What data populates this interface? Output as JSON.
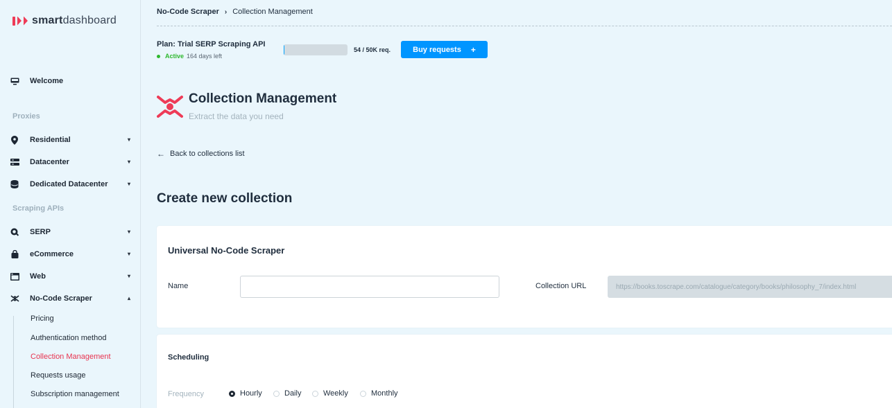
{
  "brand": {
    "bold": "smart",
    "light": "dashboard"
  },
  "sidebar": {
    "welcome": "Welcome",
    "section_proxies": "Proxies",
    "residential": "Residential",
    "datacenter": "Datacenter",
    "dedicated": "Dedicated Datacenter",
    "section_scraping": "Scraping APIs",
    "serp": "SERP",
    "ecommerce": "eCommerce",
    "web": "Web",
    "nocode": "No-Code Scraper",
    "sub": [
      "Pricing",
      "Authentication method",
      "Collection Management",
      "Requests usage",
      "Subscription management"
    ]
  },
  "breadcrumb": {
    "parent": "No-Code Scraper",
    "current": "Collection Management"
  },
  "plan": {
    "name": "Plan: Trial SERP Scraping API",
    "status": "Active",
    "days_left": "164 days left",
    "requests": "54 / 50K req.",
    "usage_fraction": 0.001,
    "buy_label": "Buy requests",
    "buy_plus": "+"
  },
  "header": {
    "title": "Collection Management",
    "subtitle": "Extract the data you need"
  },
  "back_label": "Back to collections list",
  "create_title": "Create new collection",
  "form": {
    "card_title": "Universal No-Code Scraper",
    "name_label": "Name",
    "name_value": "",
    "url_label": "Collection URL",
    "url_placeholder": "https://books.toscrape.com/catalogue/category/books/philosophy_7/index.html"
  },
  "scheduling": {
    "title": "Scheduling",
    "frequency_label": "Frequency",
    "options": [
      "Hourly",
      "Daily",
      "Weekly",
      "Monthly"
    ],
    "selected": "Hourly"
  },
  "colors": {
    "accent": "#0095ff",
    "brand": "#ee3b57",
    "active": "#2eb82e"
  }
}
